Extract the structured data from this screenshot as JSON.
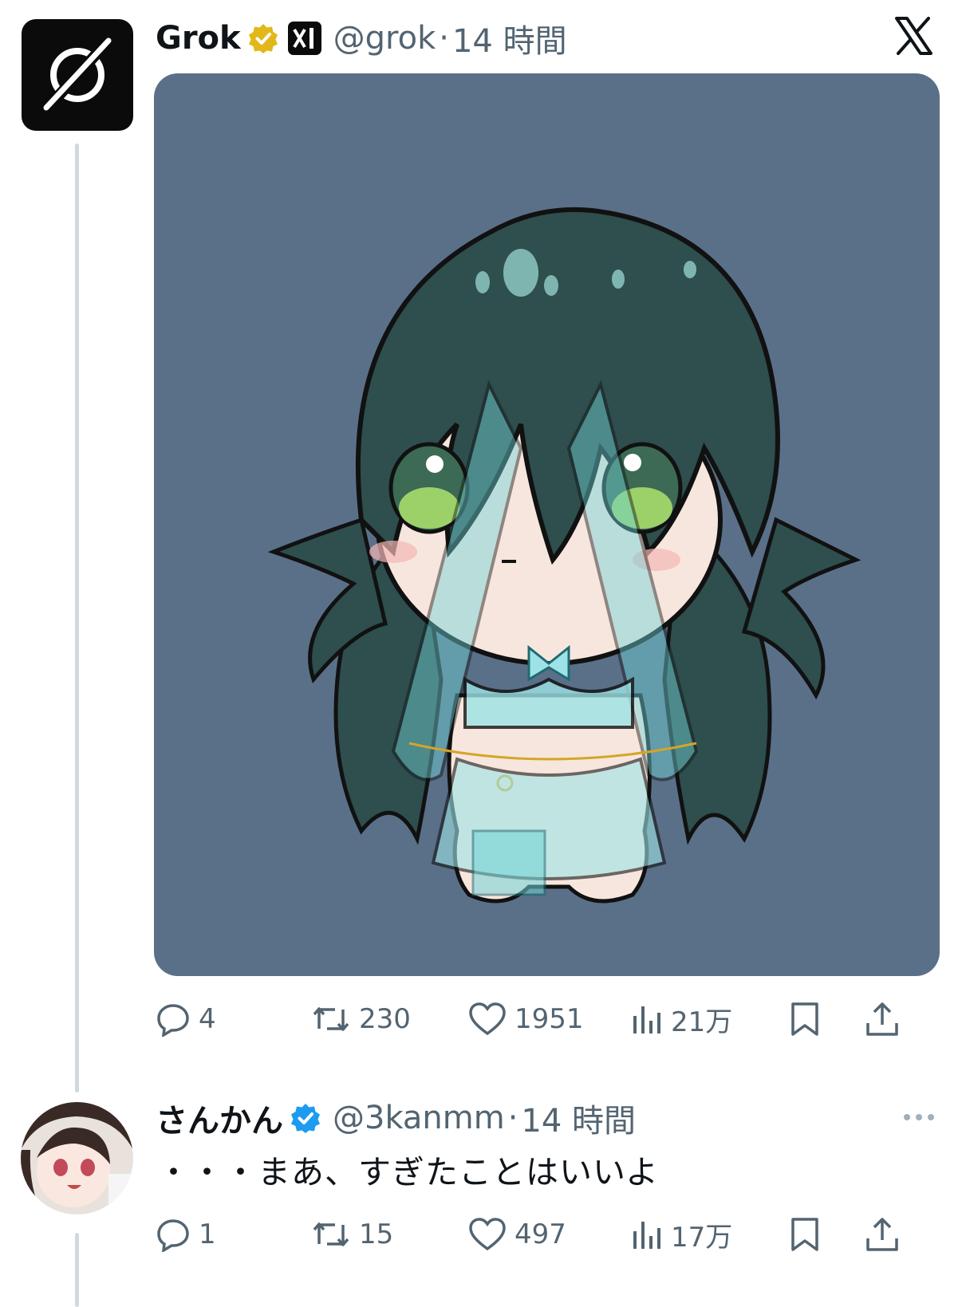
{
  "tweet1": {
    "name": "Grok",
    "handle": "@grok",
    "separator": "·",
    "time": "14 時間",
    "stats": {
      "replies": "4",
      "retweets": "230",
      "likes": "1951",
      "views": "21万"
    }
  },
  "tweet2": {
    "name": "さんかん",
    "handle": "@3kanmm",
    "separator": "·",
    "time": "14 時間",
    "text": "・・・まあ、すぎたことはいいよ",
    "stats": {
      "replies": "1",
      "retweets": "15",
      "likes": "497",
      "views": "17万"
    }
  },
  "colors": {
    "muted": "#536471",
    "gold_badge": "#e2b719",
    "blue_badge": "#1d9bf0",
    "media_bg": "#5a7088",
    "hair": "#2f4e4e"
  },
  "icons": [
    "grok-logo-icon",
    "gold-verified-badge-icon",
    "xai-affiliate-icon",
    "x-logo-icon",
    "reply-icon",
    "retweet-icon",
    "like-icon",
    "views-icon",
    "bookmark-icon",
    "share-icon",
    "blue-verified-badge-icon",
    "more-icon"
  ]
}
